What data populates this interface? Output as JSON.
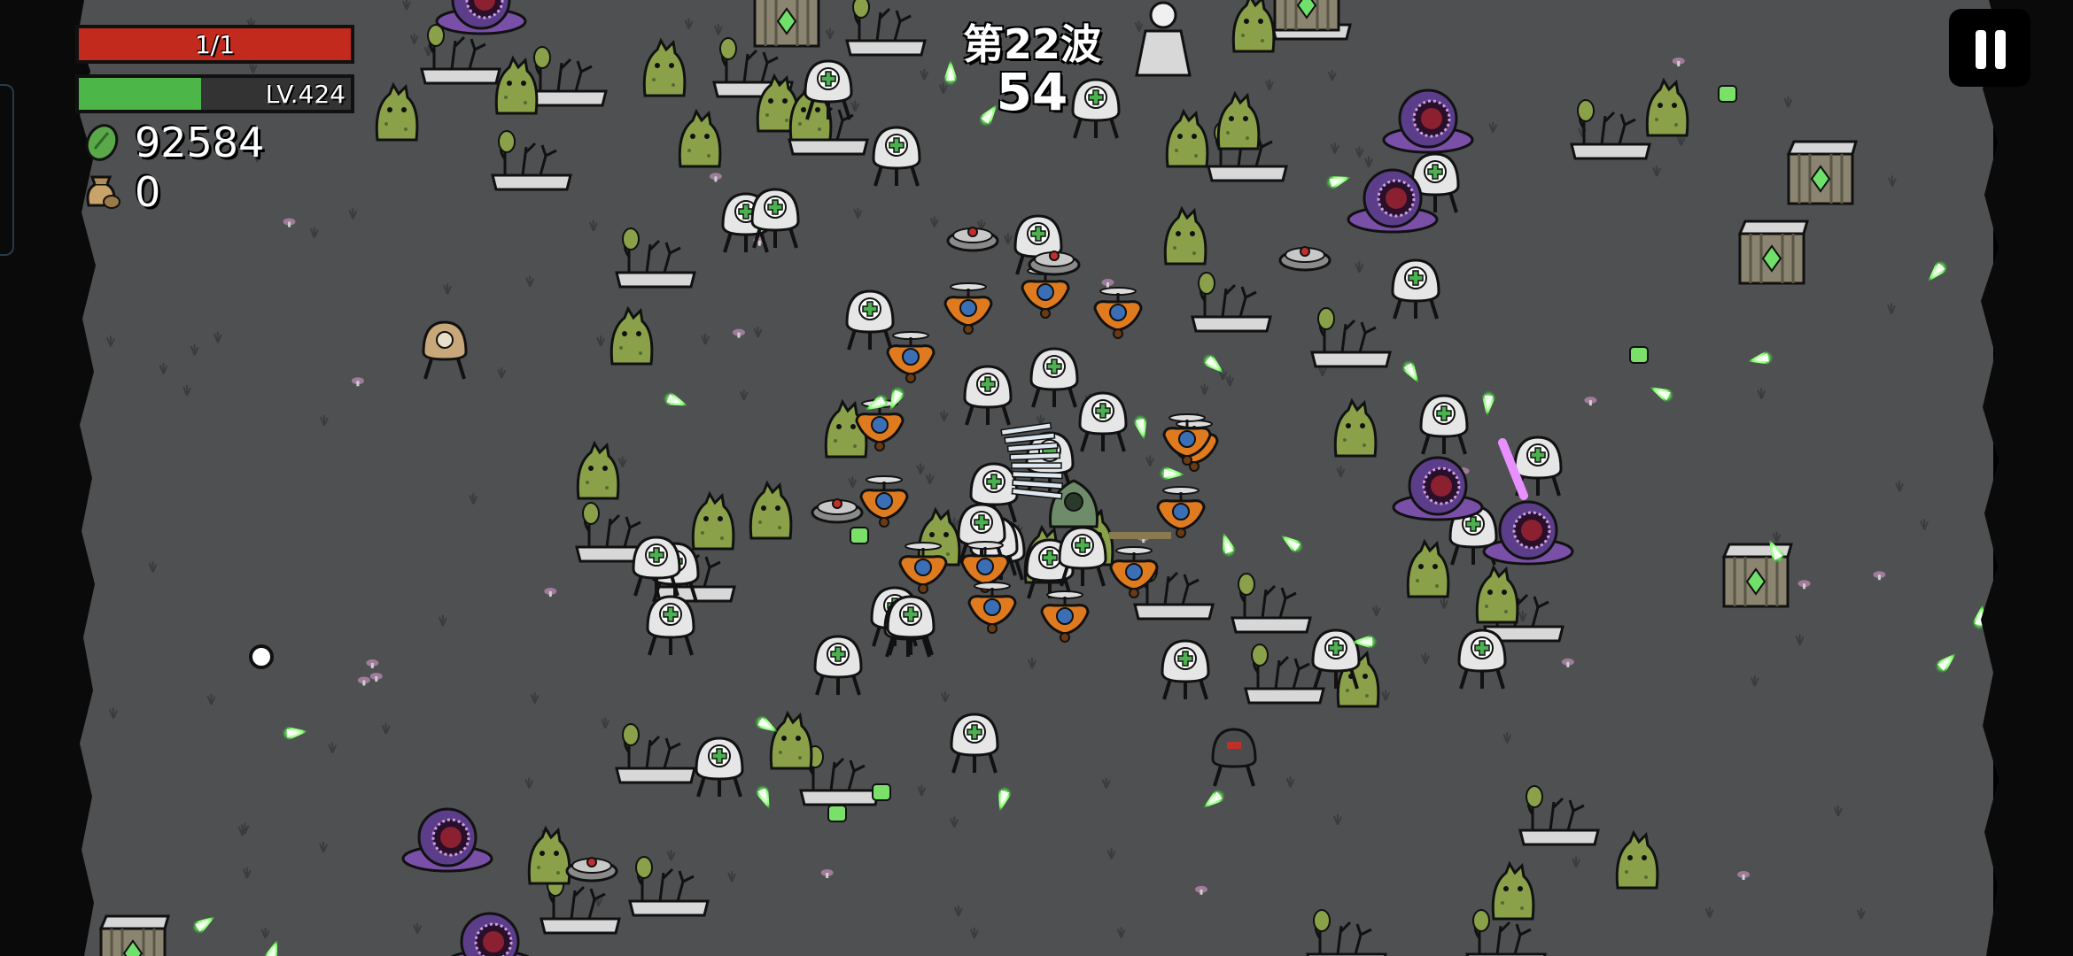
{
  "hud": {
    "health": {
      "text": "1/1",
      "fraction": 1.0,
      "color": "#c22a1e"
    },
    "level": {
      "text": "LV.424",
      "fraction": 0.45,
      "color": "#4cb648"
    },
    "materials": {
      "value": "92584",
      "icon": "green-material-icon"
    },
    "bag": {
      "value": "0",
      "icon": "money-bag-icon"
    }
  },
  "wave": {
    "title": "第22波",
    "timer": "54"
  },
  "controls": {
    "pause_icon": "pause-icon"
  },
  "colors": {
    "ground": "#4e5051",
    "border": "#0a0a0a",
    "enemy_green": "#8aa14a",
    "projectile": "#7dff6a",
    "drone_orange": "#e07a1e",
    "purple_slime": "#7a4fa8"
  },
  "scene": {
    "player_icon": "potato-hero-icon",
    "entities": [
      "zombie-plant-icon",
      "planter-box-icon",
      "medic-robot-icon",
      "orange-drone-icon",
      "purple-slime-icon",
      "crate-icon",
      "landmine-icon",
      "green-projectile-icon"
    ]
  }
}
